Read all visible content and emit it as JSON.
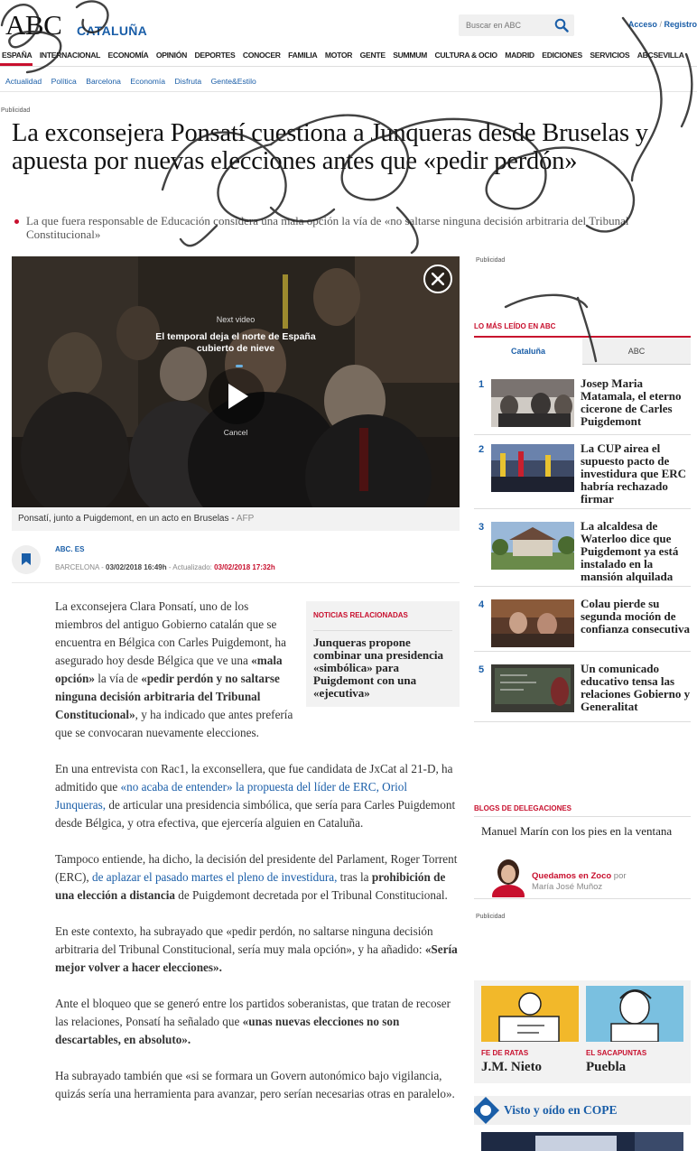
{
  "header": {
    "logo": "ABC",
    "region": "CATALUÑA",
    "search_placeholder": "Buscar en ABC",
    "login": "Acceso",
    "login_sep": "/",
    "register": "Registro"
  },
  "mainnav": [
    "ESPAÑA",
    "INTERNACIONAL",
    "ECONOMÍA",
    "OPINIÓN",
    "DEPORTES",
    "CONOCER",
    "FAMILIA",
    "MOTOR",
    "GENTE",
    "SUMMUM",
    "CULTURA & OCIO",
    "MADRID",
    "EDICIONES",
    "SERVICIOS",
    "ABCSEVILLA"
  ],
  "subnav": [
    "Actualidad",
    "Política",
    "Barcelona",
    "Economía",
    "Disfruta",
    "Gente&Estilo"
  ],
  "ad_label": "Publicidad",
  "article": {
    "headline": "La exconsejera Ponsatí cuestiona a Junqueras desde Bruselas y apuesta por nuevas elecciones antes que «pedir perdón»",
    "subtitle": "La que fuera responsable de Educación considera una mala opción la vía de «no saltarse ninguna decisión arbitraria del Tribunal Constitucional»",
    "video": {
      "next_label": "Next video",
      "next_title": "El temporal deja el norte de España cubierto de nieve",
      "cancel": "Cancel"
    },
    "caption": "Ponsatí, junto a Puigdemont, en un acto en Bruselas - ",
    "caption_source": "AFP",
    "byline": {
      "source": "ABC. ES",
      "place": "BARCELONA",
      "sep1": " - ",
      "date": "03/02/2018 16:49h",
      "updated_label": " - Actualizado: ",
      "updated": "03/02/2018 17:32h"
    },
    "related": {
      "heading": "NOTICIAS RELACIONADAS",
      "title": "Junqueras propone combinar una presidencia «simbólica» para Puigdemont con una «ejecutiva»"
    },
    "p1": {
      "a": "La exconsejera Clara Ponsatí, uno de los miembros del antiguo Gobierno catalán que se encuentra en Bélgica con Carles Puigdemont, ha asegurado hoy desde Bélgica que ve una ",
      "b": "«mala opción»",
      "c": " la vía de ",
      "d": "«pedir perdón y no saltarse ninguna decisión arbitraria del Tribunal Constitucional»",
      "e": ", y ha indicado que antes prefería que se convocaran nuevamente elecciones."
    },
    "p2": {
      "a": "En una entrevista con Rac1, la exconsellera, que fue candidata de JxCat al 21-D, ha admitido que ",
      "link": "«no acaba de entender» la propuesta del líder de ERC, Oriol Junqueras,",
      "b": " de articular una presidencia simbólica, que sería para Carles Puigdemont desde Bélgica, y otra efectiva, que ejercería alguien en Cataluña."
    },
    "p3": {
      "a": "Tampoco entiende, ha dicho, la decisión del presidente del Parlament, Roger Torrent (ERC), ",
      "link": "de aplazar el pasado martes el pleno de investidura,",
      "b": " tras la ",
      "c": "prohibición de una elección a distancia",
      "d": " de Puigdemont decretada por el Tribunal Constitucional."
    },
    "p4": {
      "a": "En este contexto, ha subrayado que «pedir perdón, no saltarse ninguna decisión arbitraria del Tribunal Constitucional, sería muy mala opción», y ha añadido: ",
      "b": "«Sería mejor volver a hacer elecciones»."
    },
    "p5": {
      "a": "Ante el bloqueo que se generó entre los partidos soberanistas, que tratan de recoser las relaciones, Ponsatí ha señalado que ",
      "b": "«unas nuevas elecciones no son descartables, en absoluto»."
    },
    "p6": {
      "a": "Ha subrayado también que «si se formara un Govern autonómico bajo vigilancia, quizás sería una herramienta para avanzar, pero serían necesarias otras en paralelo»."
    }
  },
  "sidebar": {
    "most_read_heading": "LO MÁS LEÍDO EN ABC",
    "tabs": [
      "Cataluña",
      "ABC"
    ],
    "most_read": [
      {
        "num": "1",
        "title": "Josep Maria Matamala, el eterno cicerone de Carles Puigdemont"
      },
      {
        "num": "2",
        "title": "La CUP airea el supuesto pacto de investidura que ERC habría rechazado firmar"
      },
      {
        "num": "3",
        "title": "La alcaldesa de Waterloo dice que Puigdemont ya está instalado en la mansión alquilada"
      },
      {
        "num": "4",
        "title": "Colau pierde su segunda moción de confianza consecutiva"
      },
      {
        "num": "5",
        "title": "Un comunicado educativo tensa las relaciones Gobierno y Generalitat"
      }
    ],
    "blogs_heading": "BLOGS DE DELEGACIONES",
    "blog": {
      "title": "Manuel Marín con los pies en la ventana",
      "name": "Quedamos en Zoco",
      "por": " por",
      "author": "María José Muñoz"
    },
    "cartoons": [
      {
        "section": "FE DE RATAS",
        "author": "J.M. Nieto"
      },
      {
        "section": "EL SACAPUNTAS",
        "author": "Puebla"
      }
    ],
    "cope": "Visto y oído en COPE"
  },
  "colors": {
    "accent": "#c8102e",
    "link": "#1a5ea8"
  }
}
